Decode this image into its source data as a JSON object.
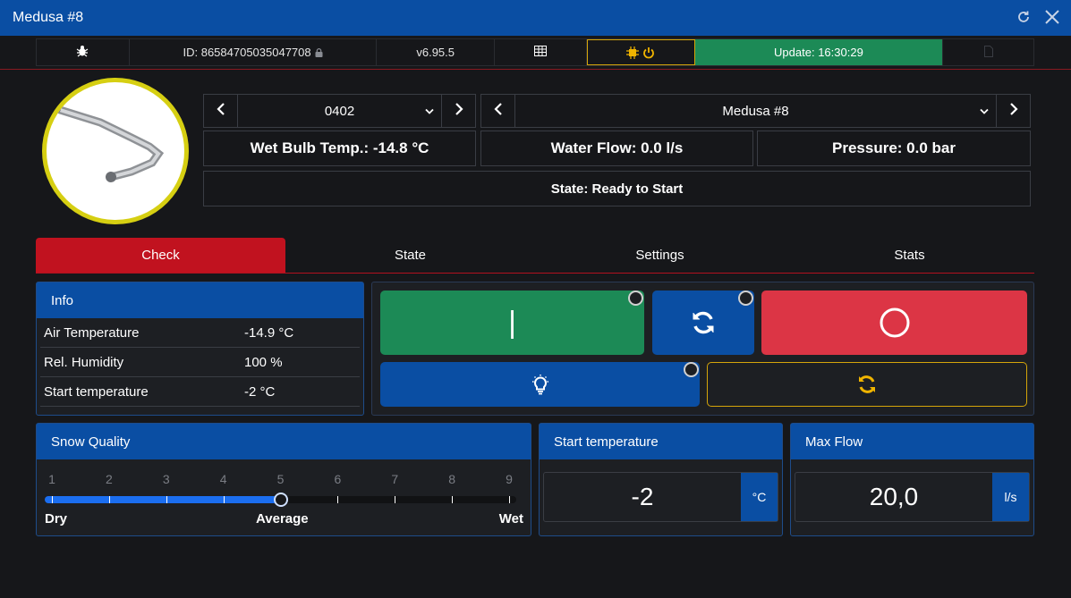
{
  "window": {
    "title": "Medusa #8"
  },
  "icons": {
    "refresh": "refresh-icon",
    "close": "close-icon",
    "bug": "bug-icon",
    "lock": "lock-icon",
    "calendar": "calendar-grid-icon",
    "chip": "chip-icon",
    "power": "power-icon",
    "file": "file-icon",
    "prev": "chevron-left-icon",
    "next": "chevron-right-icon",
    "dropdown": "chevron-down-icon",
    "start": "start-bar-icon",
    "cycle": "sync-icon",
    "stop": "stop-circle-icon",
    "light": "lightbulb-icon",
    "reload": "reload-icon"
  },
  "statusbar": {
    "id_label": "ID: 86584705035047708",
    "version": "v6.95.5",
    "update": "Update: 16:30:29"
  },
  "nav": {
    "left_select": "0402",
    "right_select": "Medusa #8"
  },
  "readouts": {
    "wet_bulb": "Wet Bulb Temp.: -14.8 °C",
    "water_flow": "Water Flow: 0.0 l/s",
    "pressure": "Pressure: 0.0 bar",
    "state": "State: Ready to Start"
  },
  "tabs": [
    {
      "label": "Check",
      "active": true
    },
    {
      "label": "State",
      "active": false
    },
    {
      "label": "Settings",
      "active": false
    },
    {
      "label": "Stats",
      "active": false
    }
  ],
  "info": {
    "title": "Info",
    "rows": [
      {
        "key": "Air Temperature",
        "value": "-14.9 °C"
      },
      {
        "key": "Rel. Humidity",
        "value": "100 %"
      },
      {
        "key": "Start temperature",
        "value": "-2 °C"
      }
    ]
  },
  "controls": {
    "start_label": "|",
    "colors": {
      "start": "#1c8a56",
      "cycle": "#0a4ea3",
      "stop": "#dc3545",
      "light": "#0a4ea3",
      "warning": "#f0b400"
    }
  },
  "snow_quality": {
    "title": "Snow Quality",
    "scale": [
      "1",
      "2",
      "3",
      "4",
      "5",
      "6",
      "7",
      "8",
      "9"
    ],
    "value": 5,
    "labels": {
      "left": "Dry",
      "middle": "Average",
      "right": "Wet"
    }
  },
  "start_temperature": {
    "title": "Start temperature",
    "value": "-2",
    "unit": "°C"
  },
  "max_flow": {
    "title": "Max Flow",
    "value": "20,0",
    "unit": "l/s"
  }
}
